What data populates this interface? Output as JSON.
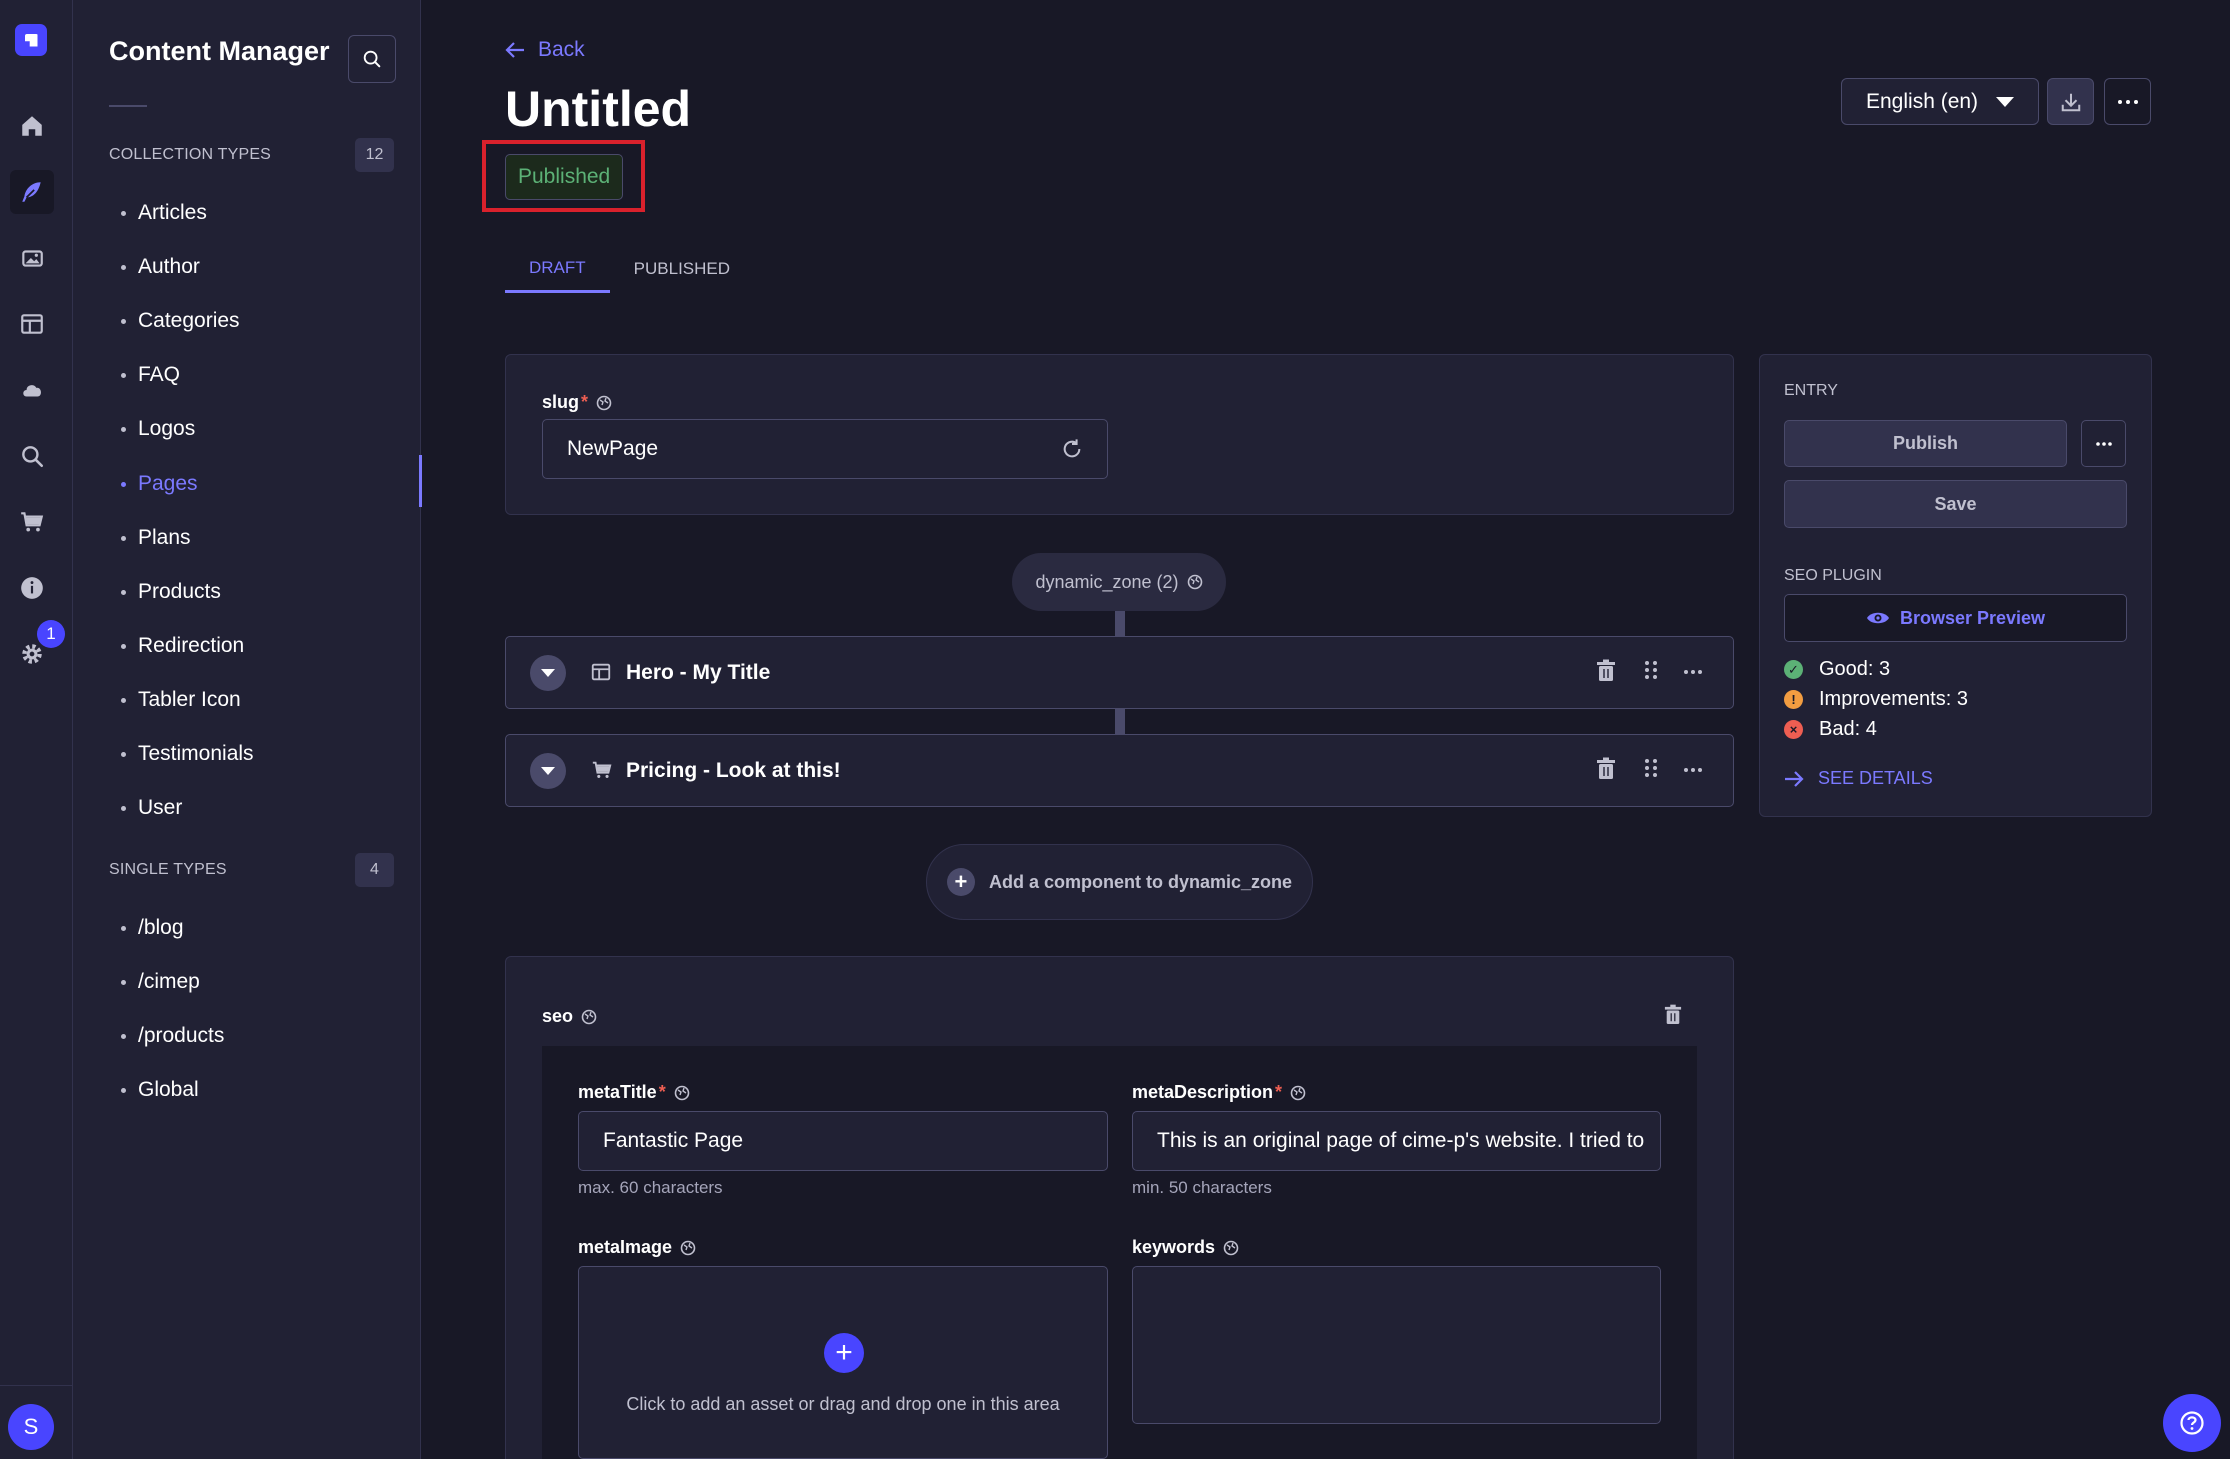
{
  "rail": {
    "badge_count": "1",
    "avatar_initial": "S",
    "items": [
      "home-icon",
      "content-manager-icon",
      "media-library-icon",
      "content-type-builder-icon",
      "cloud-icon",
      "search-icon",
      "cart-icon",
      "info-icon",
      "settings-icon"
    ]
  },
  "sidebar": {
    "title": "Content Manager",
    "collection_section": "COLLECTION TYPES",
    "collection_count": "12",
    "collection_items": [
      "Articles",
      "Author",
      "Categories",
      "FAQ",
      "Logos",
      "Pages",
      "Plans",
      "Products",
      "Redirection",
      "Tabler Icon",
      "Testimonials",
      "User"
    ],
    "active_item": "Pages",
    "single_section": "SINGLE TYPES",
    "single_count": "4",
    "single_items": [
      "/blog",
      "/cimep",
      "/products",
      "Global"
    ]
  },
  "header": {
    "back_label": "Back",
    "title": "Untitled",
    "status": "Published",
    "locale": "English (en)"
  },
  "tabs": [
    {
      "label": "DRAFT",
      "active": true
    },
    {
      "label": "PUBLISHED",
      "active": false
    }
  ],
  "slug": {
    "label": "slug",
    "required": "*",
    "value": "NewPage"
  },
  "dynamic_zone": {
    "label": "dynamic_zone (2)",
    "components": [
      {
        "icon": "layout-icon",
        "label": "Hero - My Title"
      },
      {
        "icon": "cart-icon",
        "label": "Pricing - Look at this!"
      }
    ],
    "add_label": "Add a component to dynamic_zone"
  },
  "seo": {
    "label": "seo",
    "meta_title": {
      "label": "metaTitle",
      "required": "*",
      "value": "Fantastic Page",
      "hint": "max. 60 characters"
    },
    "meta_description": {
      "label": "metaDescription",
      "required": "*",
      "value": "This is an original page of cime-p's website. I tried to",
      "hint": "min. 50 characters"
    },
    "meta_image": {
      "label": "metaImage",
      "upload_text": "Click to add an asset or drag and drop one in this area"
    },
    "keywords": {
      "label": "keywords",
      "value": ""
    }
  },
  "entry": {
    "section": "ENTRY",
    "publish_label": "Publish",
    "save_label": "Save"
  },
  "seo_plugin": {
    "section": "SEO PLUGIN",
    "preview_label": "Browser Preview",
    "good": "Good: 3",
    "improvements": "Improvements: 3",
    "bad": "Bad: 4",
    "details_label": "SEE DETAILS"
  },
  "colors": {
    "accent": "#7b79ff",
    "primary": "#4945ff",
    "success": "#5cb176",
    "warning": "#f29d41",
    "danger": "#ee5e52",
    "highlight": "#d9212c"
  }
}
